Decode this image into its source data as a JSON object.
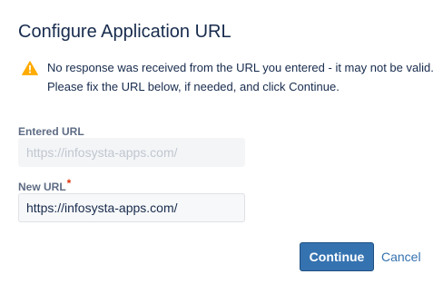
{
  "dialog": {
    "title": "Configure Application URL",
    "warning": {
      "icon": "warning-icon",
      "message": "No response was received from the URL you entered - it may not be valid. Please fix the URL below, if needed, and click Continue."
    },
    "entered_url": {
      "label": "Entered URL",
      "value": "https://infosysta-apps.com/"
    },
    "new_url": {
      "label": "New URL",
      "required_marker": "*",
      "value": "https://infosysta-apps.com/"
    },
    "actions": {
      "continue_label": "Continue",
      "cancel_label": "Cancel"
    }
  },
  "colors": {
    "primary": "#3572b0",
    "warning": "#ffab00",
    "required": "#de350b"
  }
}
